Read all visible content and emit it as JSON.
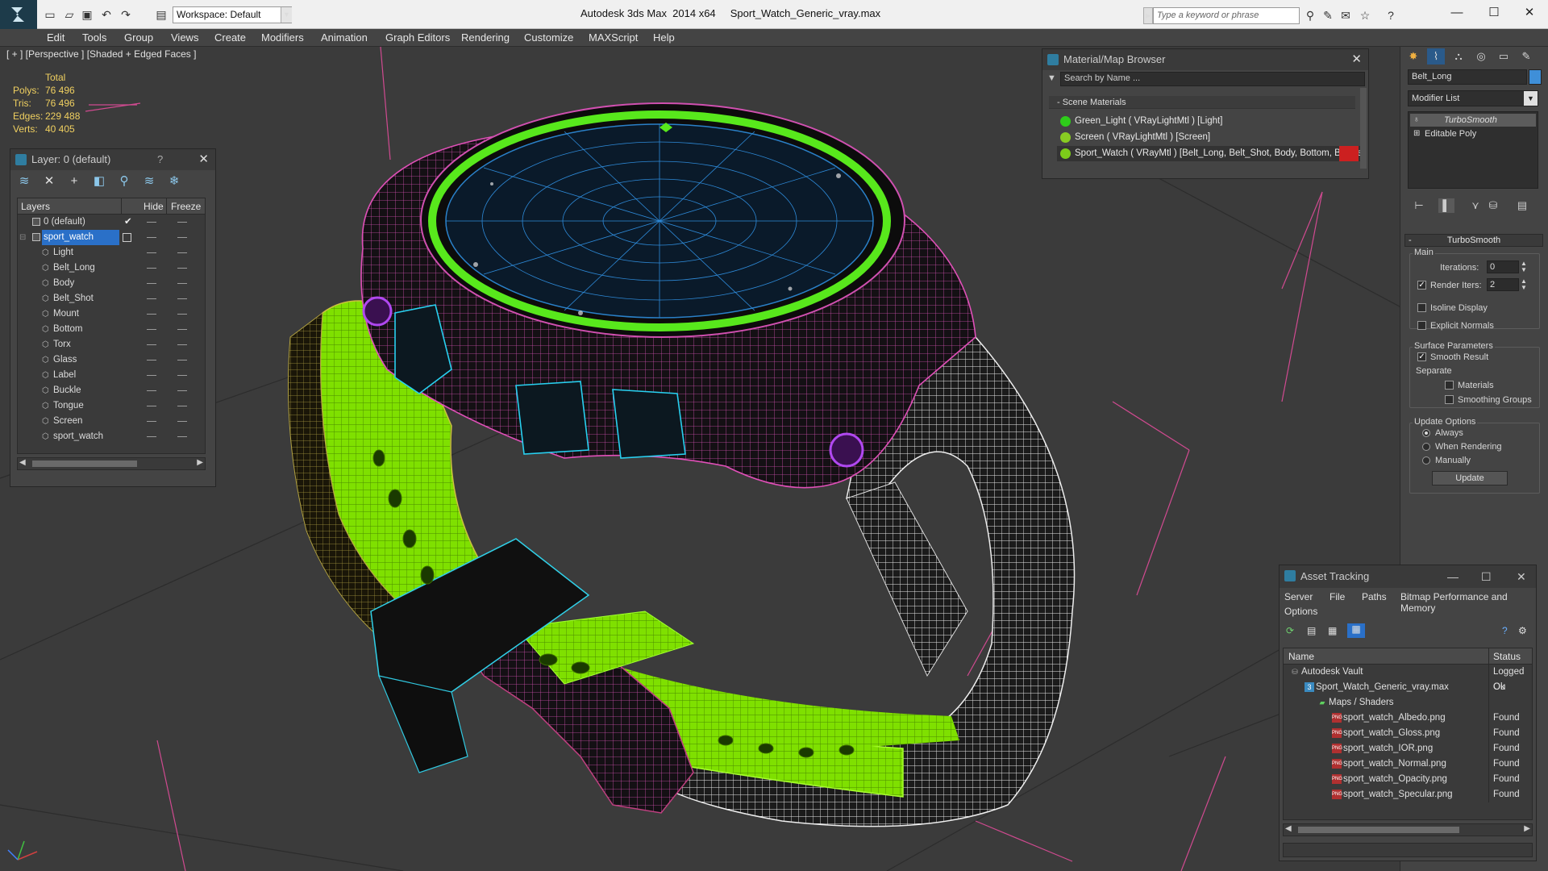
{
  "app": {
    "workspace_label": "Workspace: Default",
    "app_name": "Autodesk 3ds Max  2014 x64",
    "file_name": "Sport_Watch_Generic_vray.max",
    "keyword_placeholder": "Type a keyword or phrase"
  },
  "menu": [
    "Edit",
    "Tools",
    "Group",
    "Views",
    "Create",
    "Modifiers",
    "Animation",
    "Graph Editors",
    "Rendering",
    "Customize",
    "MAXScript",
    "Help"
  ],
  "viewport": {
    "label": "[ + ] [Perspective ] [Shaded + Edged Faces ]",
    "stats": {
      "header": "Total",
      "rows": [
        {
          "label": "Polys:",
          "value": "76 496"
        },
        {
          "label": "Tris:",
          "value": "76 496"
        },
        {
          "label": "Edges:",
          "value": "229 488"
        },
        {
          "label": "Verts:",
          "value": "40 405"
        }
      ]
    },
    "colors": {
      "wire_green": "#86e800",
      "wire_pink": "#e060c0",
      "wire_white": "#f0f0f0",
      "wire_cyan": "#20d8f0",
      "ring_green": "#57e81c",
      "purple": "#a040e0"
    }
  },
  "layer_panel": {
    "title": "Layer: 0 (default)",
    "help": "?",
    "columns": {
      "layers": "Layers",
      "hide": "Hide",
      "freeze": "Freeze"
    },
    "default_layer": "0 (default)",
    "selected_layer": "sport_watch",
    "children": [
      "Light",
      "Belt_Long",
      "Body",
      "Belt_Shot",
      "Mount",
      "Bottom",
      "Torx",
      "Glass",
      "Label",
      "Buckle",
      "Tongue",
      "Screen",
      "sport_watch"
    ]
  },
  "material_browser": {
    "title": "Material/Map Browser",
    "search_placeholder": "Search by Name ...",
    "section": "- Scene Materials",
    "items": [
      {
        "text": "Green_Light  ( VRayLightMtl )  [Light]",
        "color": "#2ecc1a"
      },
      {
        "text": "Screen  ( VRayLightMtl )  [Screen]",
        "color": "#88cc22"
      },
      {
        "text": "Sport_Watch  ( VRayMtl )  [Belt_Long, Belt_Shot, Body, Bottom, Buckle,...",
        "color": "#7ccc1a"
      }
    ]
  },
  "command_panel": {
    "object_name": "Belt_Long",
    "modifier_list": "Modifier List",
    "stack": [
      "TurboSmooth",
      "Editable Poly"
    ],
    "rollout_title": "TurboSmooth",
    "main_label": "Main",
    "iterations_label": "Iterations:",
    "iterations_value": "0",
    "render_iters_label": "Render Iters:",
    "render_iters_value": "2",
    "isoline": "Isoline Display",
    "explicit_normals": "Explicit Normals",
    "surface_params": "Surface Parameters",
    "smooth_result": "Smooth Result",
    "separate": "Separate",
    "materials": "Materials",
    "smoothing_groups": "Smoothing Groups",
    "update_options": "Update Options",
    "always": "Always",
    "when_rendering": "When Rendering",
    "manually": "Manually",
    "update_button": "Update"
  },
  "asset_tracking": {
    "title": "Asset Tracking",
    "menu": [
      "Server",
      "File",
      "Paths",
      "Bitmap Performance and Memory",
      "Options"
    ],
    "columns": {
      "name": "Name",
      "status": "Status"
    },
    "rows": [
      {
        "name": "Autodesk Vault",
        "status": "Logged Ou"
      },
      {
        "name": "Sport_Watch_Generic_vray.max",
        "status": "Ok"
      },
      {
        "name": "Maps / Shaders",
        "status": ""
      },
      {
        "name": "sport_watch_Albedo.png",
        "status": "Found"
      },
      {
        "name": "sport_watch_Gloss.png",
        "status": "Found"
      },
      {
        "name": "sport_watch_IOR.png",
        "status": "Found"
      },
      {
        "name": "sport_watch_Normal.png",
        "status": "Found"
      },
      {
        "name": "sport_watch_Opacity.png",
        "status": "Found"
      },
      {
        "name": "sport_watch_Specular.png",
        "status": "Found"
      }
    ]
  }
}
